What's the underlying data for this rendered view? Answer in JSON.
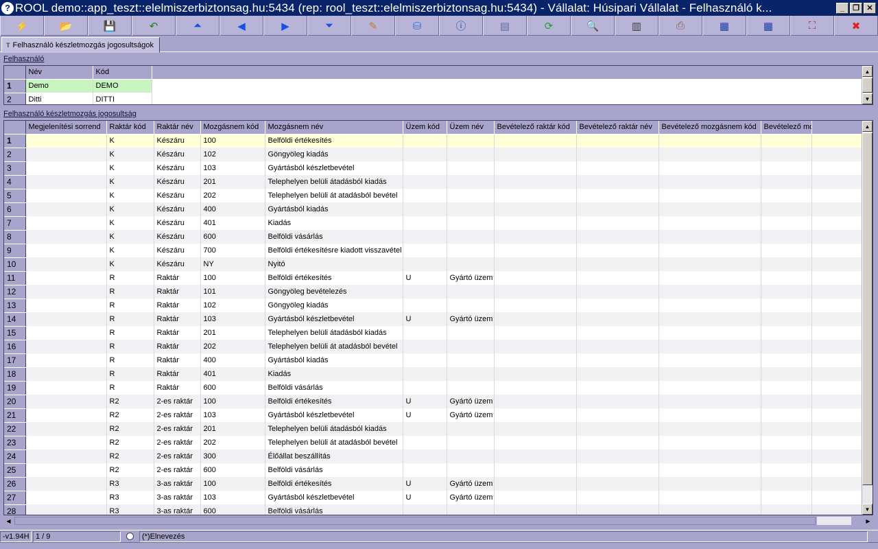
{
  "window": {
    "title": "ROOL demo::app_teszt::elelmiszerbiztonsag.hu:5434 (rep: rool_teszt::elelmiszerbiztonsag.hu:5434) - Vállalat: Húsipari Vállalat - Felhasználó k..."
  },
  "toolbar": {
    "buttons": [
      {
        "name": "execute",
        "icon": "⚡",
        "color": "#e08020"
      },
      {
        "name": "open",
        "icon": "📂",
        "color": "#3060c0"
      },
      {
        "name": "save",
        "icon": "💾",
        "color": "#203080"
      },
      {
        "name": "undo",
        "icon": "↶",
        "color": "#208020"
      },
      {
        "name": "first",
        "icon": "⏶",
        "color": "#1850e0"
      },
      {
        "name": "prev",
        "icon": "◀",
        "color": "#1850e0"
      },
      {
        "name": "next",
        "icon": "▶",
        "color": "#1850e0"
      },
      {
        "name": "last",
        "icon": "⏷",
        "color": "#1850e0"
      },
      {
        "name": "edit",
        "icon": "✎",
        "color": "#c08020"
      },
      {
        "name": "database",
        "icon": "⛁",
        "color": "#3070d0"
      },
      {
        "name": "info",
        "icon": "ⓘ",
        "color": "#1850c0"
      },
      {
        "name": "form",
        "icon": "▤",
        "color": "#6070a0"
      },
      {
        "name": "refresh",
        "icon": "⟳",
        "color": "#20a030"
      },
      {
        "name": "search",
        "icon": "🔍",
        "color": "#806020"
      },
      {
        "name": "columns",
        "icon": "▥",
        "color": "#404040"
      },
      {
        "name": "print",
        "icon": "⎙",
        "color": "#806040"
      },
      {
        "name": "grid-export",
        "icon": "▦",
        "color": "#2040a0"
      },
      {
        "name": "grid-import",
        "icon": "▦",
        "color": "#2040a0"
      },
      {
        "name": "fullscreen",
        "icon": "⛶",
        "color": "#c02020"
      },
      {
        "name": "close",
        "icon": "✖",
        "color": "#e02020"
      }
    ]
  },
  "tab": {
    "label": "Felhasználó készletmozgás jogosultságok",
    "icon": "T"
  },
  "users": {
    "section_label": "Felhasználó",
    "columns": [
      "Név",
      "Kód"
    ],
    "rows": [
      {
        "num": "1",
        "name": "Demo",
        "code": "DEMO"
      },
      {
        "num": "2",
        "name": "Ditti",
        "code": "DITTI"
      }
    ]
  },
  "rights": {
    "section_label": "Felhasználó készletmozgás jogosultság",
    "columns": [
      "Megjelenítési sorrend",
      "Raktár kód",
      "Raktár név",
      "Mozgásnem kód",
      "Mozgásnem név",
      "Üzem kód",
      "Üzem név",
      "Bevételező raktár kód",
      "Bevételező raktár név",
      "Bevételező mozgásnem kód",
      "Bevételező mozgásnem név"
    ],
    "rows": [
      [
        "1",
        "",
        "K",
        "Készáru",
        "100",
        "Belföldi értékesítés",
        "",
        ""
      ],
      [
        "2",
        "",
        "K",
        "Készáru",
        "102",
        "Göngyöleg  kiadás",
        "",
        ""
      ],
      [
        "3",
        "",
        "K",
        "Készáru",
        "103",
        "Gyártásból készletbevétel",
        "",
        ""
      ],
      [
        "4",
        "",
        "K",
        "Készáru",
        "201",
        "Telephelyen belüli átadásból kiadás",
        "",
        ""
      ],
      [
        "5",
        "",
        "K",
        "Készáru",
        "202",
        "Telephelyen belüli át atadásból bevétel",
        "",
        ""
      ],
      [
        "6",
        "",
        "K",
        "Készáru",
        "400",
        "Gyártásból kiadás",
        "",
        ""
      ],
      [
        "7",
        "",
        "K",
        "Készáru",
        "401",
        "Kiadás",
        "",
        ""
      ],
      [
        "8",
        "",
        "K",
        "Készáru",
        "600",
        "Belföldi vásárlás",
        "",
        ""
      ],
      [
        "9",
        "",
        "K",
        "Készáru",
        "700",
        "Belföldi értékesítésre kiadott visszavétel",
        "",
        ""
      ],
      [
        "10",
        "",
        "K",
        "Készáru",
        "NY",
        "Nyitó",
        "",
        ""
      ],
      [
        "11",
        "",
        "R",
        "Raktár",
        "100",
        "Belföldi értékesítés",
        "U",
        "Gyártó üzem"
      ],
      [
        "12",
        "",
        "R",
        "Raktár",
        "101",
        "Göngyöleg bevételezés",
        "",
        ""
      ],
      [
        "13",
        "",
        "R",
        "Raktár",
        "102",
        "Göngyöleg  kiadás",
        "",
        ""
      ],
      [
        "14",
        "",
        "R",
        "Raktár",
        "103",
        "Gyártásból készletbevétel",
        "U",
        "Gyártó üzem"
      ],
      [
        "15",
        "",
        "R",
        "Raktár",
        "201",
        "Telephelyen belüli átadásból kiadás",
        "",
        ""
      ],
      [
        "16",
        "",
        "R",
        "Raktár",
        "202",
        "Telephelyen belüli át atadásból bevétel",
        "",
        ""
      ],
      [
        "17",
        "",
        "R",
        "Raktár",
        "400",
        "Gyártásból kiadás",
        "",
        ""
      ],
      [
        "18",
        "",
        "R",
        "Raktár",
        "401",
        "Kiadás",
        "",
        ""
      ],
      [
        "19",
        "",
        "R",
        "Raktár",
        "600",
        "Belföldi vásárlás",
        "",
        ""
      ],
      [
        "20",
        "",
        "R2",
        "2-es raktár",
        "100",
        "Belföldi értékesítés",
        "U",
        "Gyártó üzem"
      ],
      [
        "21",
        "",
        "R2",
        "2-es raktár",
        "103",
        "Gyártásból készletbevétel",
        "U",
        "Gyártó üzem"
      ],
      [
        "22",
        "",
        "R2",
        "2-es raktár",
        "201",
        "Telephelyen belüli átadásból kiadás",
        "",
        ""
      ],
      [
        "23",
        "",
        "R2",
        "2-es raktár",
        "202",
        "Telephelyen belüli át atadásból bevétel",
        "",
        ""
      ],
      [
        "24",
        "",
        "R2",
        "2-es raktár",
        "300",
        "Élőállat beszállítás",
        "",
        ""
      ],
      [
        "25",
        "",
        "R2",
        "2-es raktár",
        "600",
        "Belföldi vásárlás",
        "",
        ""
      ],
      [
        "26",
        "",
        "R3",
        "3-as raktár",
        "100",
        "Belföldi értékesítés",
        "U",
        "Gyártó üzem"
      ],
      [
        "27",
        "",
        "R3",
        "3-as raktár",
        "103",
        "Gyártásból készletbevétel",
        "U",
        "Gyártó üzem"
      ],
      [
        "28",
        "",
        "R3",
        "3-as raktár",
        "600",
        "Belföldi vásárlás",
        "",
        ""
      ]
    ]
  },
  "status": {
    "version": "-v1.94H",
    "record": "1 / 9",
    "naming": "(*)Elnevezés"
  }
}
